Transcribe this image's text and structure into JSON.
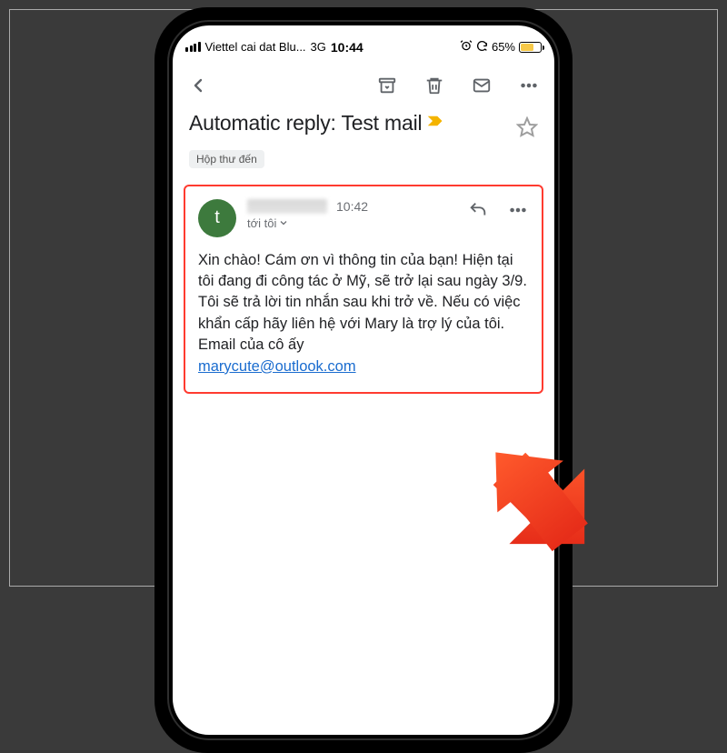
{
  "status": {
    "carrier": "Viettel cai dat Blu...",
    "network": "3G",
    "time": "10:44",
    "battery_pct": "65%",
    "battery_fill_width": "65%"
  },
  "subject": "Automatic reply: Test mail",
  "inbox_label": "Hộp thư đến",
  "sender": {
    "avatar_letter": "t",
    "time": "10:42",
    "recipient_line": "tới tôi"
  },
  "body": {
    "text": "Xin chào! Cám ơn vì thông tin của bạn! Hiện tại tôi đang đi công tác ở Mỹ, sẽ trở lại sau ngày 3/9. Tôi sẽ trả lời tin nhắn sau khi trở về. Nếu có việc khẩn cấp hãy liên hệ với Mary là trợ lý của tôi. Email của cô ấy",
    "link": "marycute@outlook.com"
  }
}
